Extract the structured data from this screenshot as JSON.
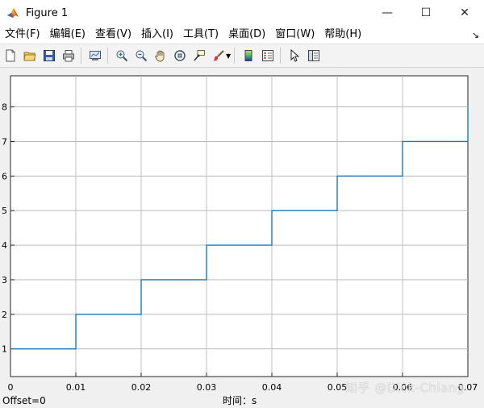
{
  "window": {
    "title": "Figure 1",
    "minimize": "—",
    "maximize": "☐",
    "close": "✕"
  },
  "menu": [
    "文件(F)",
    "编辑(E)",
    "查看(V)",
    "插入(I)",
    "工具(T)",
    "桌面(D)",
    "窗口(W)",
    "帮助(H)"
  ],
  "toolbar": [
    "new-file-icon",
    "open-folder-icon",
    "save-icon",
    "print-icon",
    "link-plot-icon",
    "zoom-in-icon",
    "zoom-out-icon",
    "pan-hand-icon",
    "rotate-3d-icon",
    "data-cursor-icon",
    "brush-icon",
    "colorbar-icon",
    "legend-icon",
    "pointer-arrow-icon",
    "property-editor-icon"
  ],
  "status": {
    "offset": "Offset=0",
    "xlabel": "时间：s"
  },
  "watermark": "知乎 @Dick-Chiang",
  "colors": {
    "line": "#1f77b4",
    "grid": "#b0b0b0",
    "axes_bg": "#ffffff"
  },
  "chart_data": {
    "type": "line",
    "subtype": "stairs",
    "x": [
      0,
      0.01,
      0.02,
      0.03,
      0.04,
      0.05,
      0.06,
      0.07
    ],
    "y": [
      1,
      2,
      3,
      4,
      5,
      6,
      7,
      8
    ],
    "xlim": [
      0,
      0.07
    ],
    "ylim": [
      0.2,
      8.9
    ],
    "xticks": [
      0,
      0.01,
      0.02,
      0.03,
      0.04,
      0.05,
      0.06,
      0.07
    ],
    "xtick_labels": [
      "0",
      "0.01",
      "0.02",
      "0.03",
      "0.04",
      "0.05",
      "0.06",
      "0.07"
    ],
    "yticks": [
      1,
      2,
      3,
      4,
      5,
      6,
      7,
      8
    ],
    "ytick_labels": [
      "1",
      "2",
      "3",
      "4",
      "5",
      "6",
      "7",
      "8"
    ],
    "grid": true,
    "xlabel": "时间：s"
  }
}
